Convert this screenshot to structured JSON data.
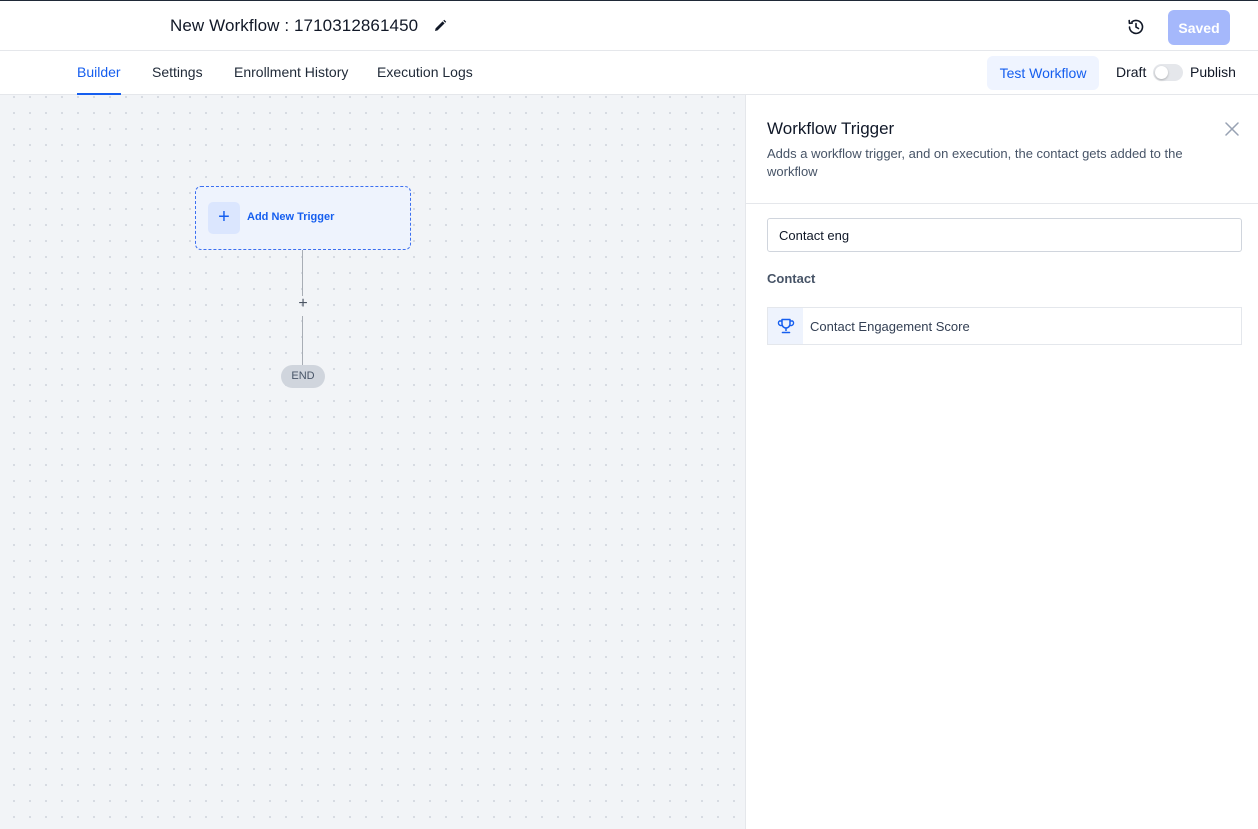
{
  "header": {
    "title": "New Workflow : 1710312861450",
    "saved_label": "Saved"
  },
  "tabs": [
    {
      "label": "Builder",
      "active": true
    },
    {
      "label": "Settings",
      "active": false
    },
    {
      "label": "Enrollment History",
      "active": false
    },
    {
      "label": "Execution Logs",
      "active": false
    }
  ],
  "toolbar": {
    "test_label": "Test Workflow",
    "draft_label": "Draft",
    "publish_label": "Publish",
    "published": false
  },
  "canvas": {
    "trigger_label": "Add New Trigger",
    "add_step_symbol": "+",
    "end_label": "END"
  },
  "panel": {
    "title": "Workflow Trigger",
    "description": "Adds a workflow trigger, and on execution, the contact gets added to the workflow",
    "search_value": "Contact eng",
    "group_label": "Contact",
    "options": [
      {
        "label": "Contact Engagement Score",
        "icon": "trophy-icon"
      }
    ]
  },
  "colors": {
    "accent": "#155eef",
    "saved_button": "#a5b8fb",
    "canvas_bg": "#f2f4f7"
  }
}
